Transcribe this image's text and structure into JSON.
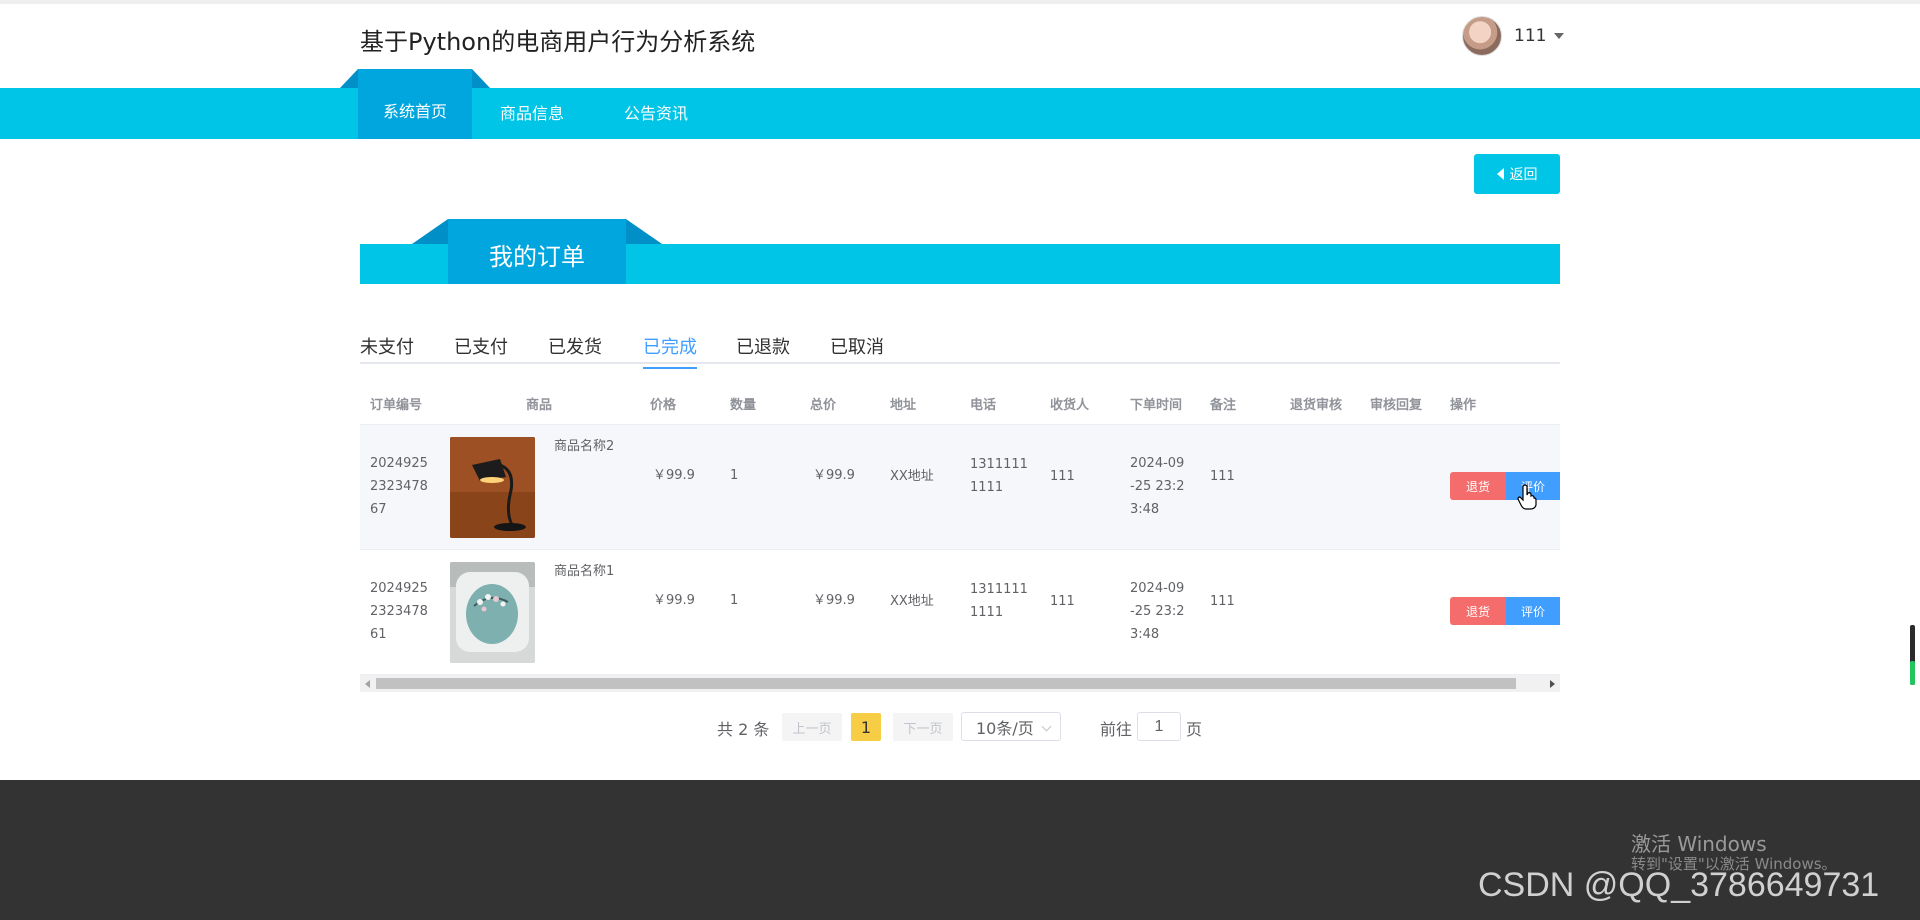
{
  "header": {
    "title": "基于Python的电商用户行为分析系统",
    "username": "111"
  },
  "nav": {
    "items": [
      {
        "label": "系统首页"
      },
      {
        "label": "商品信息"
      },
      {
        "label": "公告资讯"
      }
    ]
  },
  "back_label": "返回",
  "section_title": "我的订单",
  "status_tabs": [
    "未支付",
    "已支付",
    "已发货",
    "已完成",
    "已退款",
    "已取消"
  ],
  "active_status_tab": "已完成",
  "table": {
    "headers": [
      "订单编号",
      "商品",
      "价格",
      "数量",
      "总价",
      "地址",
      "电话",
      "收货人",
      "下单时间",
      "备注",
      "退货审核",
      "审核回复",
      "操作"
    ],
    "rows": [
      {
        "order_no": [
          "2024925",
          "2323478",
          "67"
        ],
        "product": "商品名称2",
        "price": "￥99.9",
        "qty": "1",
        "total": "￥99.9",
        "address": "XX地址",
        "phone": [
          "1311111",
          "1111"
        ],
        "receiver": "111",
        "time": [
          "2024-09",
          "-25 23:2",
          "3:48"
        ],
        "remark": "111",
        "return_review": "",
        "review_reply": "",
        "btn_return": "退货",
        "btn_review": "评价"
      },
      {
        "order_no": [
          "2024925",
          "2323478",
          "61"
        ],
        "product": "商品名称1",
        "price": "￥99.9",
        "qty": "1",
        "total": "￥99.9",
        "address": "XX地址",
        "phone": [
          "1311111",
          "1111"
        ],
        "receiver": "111",
        "time": [
          "2024-09",
          "-25 23:2",
          "3:48"
        ],
        "remark": "111",
        "return_review": "",
        "review_reply": "",
        "btn_return": "退货",
        "btn_review": "评价"
      }
    ]
  },
  "pagination": {
    "total": "共 2 条",
    "prev": "上一页",
    "current": "1",
    "next": "下一页",
    "page_size": "10条/页",
    "goto_label": "前往",
    "goto_value": "1",
    "page_label": "页"
  },
  "watermark": {
    "activate_title": "激活 Windows",
    "activate_sub": "转到\"设置\"以激活 Windows。",
    "csdn": "CSDN @QQ_3786649731"
  },
  "colors": {
    "nav": "#00c5e6",
    "nav_active": "#00a6dd",
    "tab_active": "#409eff",
    "btn_return": "#f56c6c",
    "btn_review": "#409eff",
    "page_current": "#f7cd46",
    "footer": "#333333"
  },
  "icons": [
    "avatar",
    "caret-down-icon",
    "back-triangle-icon",
    "pointer-hand-cursor-icon"
  ]
}
